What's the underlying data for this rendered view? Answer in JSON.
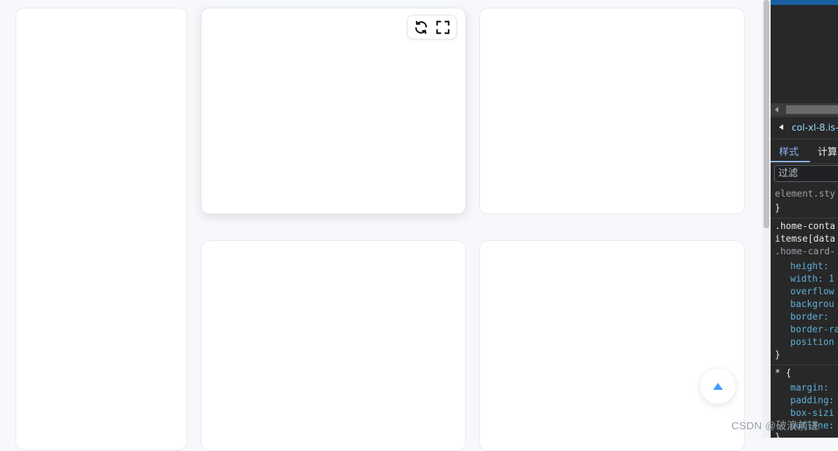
{
  "toolbar": {
    "refresh_icon": "refresh-icon",
    "fullscreen_icon": "fullscreen-icon"
  },
  "back_to_top_icon": "caret-up-icon",
  "accent_color": "#409eff",
  "watermark": "CSDN @破浪前进",
  "devtools": {
    "breadcrumb": "col-xl-8.is-c",
    "tabs": [
      "样式",
      "计算"
    ],
    "filter_placeholder": "过滤",
    "css": {
      "element_style": "element.sty",
      "element_style_close": "}",
      "rule1_selector_line1": ".home-conta",
      "rule1_selector_line2": "itemse[data",
      "rule1_source": ".home-card-",
      "rule1_props": [
        "height:",
        "width: 1",
        "overflow",
        "backgrou",
        "border: ",
        "border-ra",
        "position"
      ],
      "rule1_close": "}",
      "rule2_selector": "* {",
      "rule2_props": [
        "margin: ",
        "padding:",
        "box-sizi",
        "outline:"
      ],
      "rule2_close": "}"
    }
  }
}
